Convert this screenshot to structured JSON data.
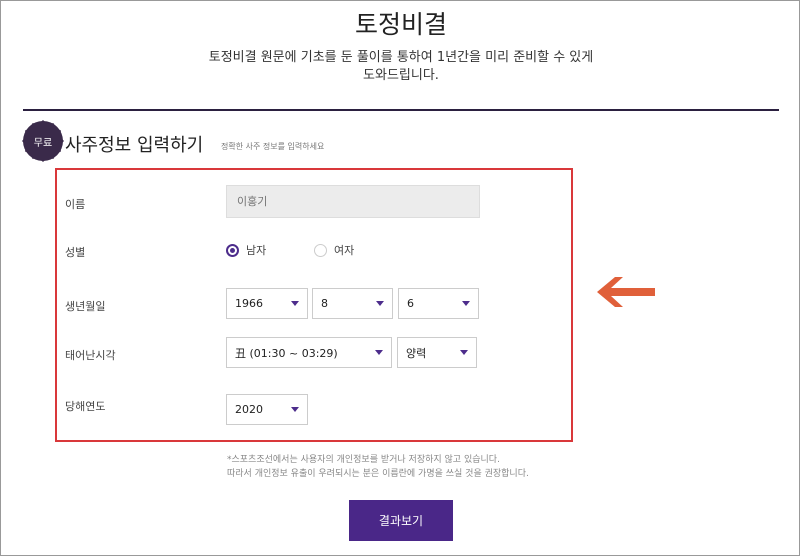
{
  "header": {
    "title": "토정비결",
    "subtitle_line1": "토정비결 원문에 기초를 둔 풀이를 통하여 1년간을 미리 준비할 수 있게",
    "subtitle_line2": "도와드립니다."
  },
  "section": {
    "badge": "무료",
    "title": "사주정보 입력하기",
    "hint": "정확한 사주 정보를 입력하세요"
  },
  "form": {
    "name_label": "이름",
    "name_placeholder": "이홍기",
    "gender_label": "성별",
    "gender_male": "남자",
    "gender_female": "여자",
    "birth_label": "생년월일",
    "birth_year": "1966",
    "birth_month": "8",
    "birth_day": "6",
    "time_label": "태어난시각",
    "time_value": "丑 (01:30 ~ 03:29)",
    "calendar_value": "양력",
    "year_label": "당해연도",
    "year_value": "2020"
  },
  "notice": {
    "line1": "*스포츠조선에서는 사용자의 개인정보를 받거나 저장하지 않고 있습니다.",
    "line2": "따라서 개인정보 유출이 우려되시는 분은 이름란에 가명을 쓰실 것을 권장합니다."
  },
  "submit_label": "결과보기",
  "colors": {
    "accent": "#4a2788",
    "highlight_border": "#d9383a",
    "arrow": "#e0603a"
  }
}
